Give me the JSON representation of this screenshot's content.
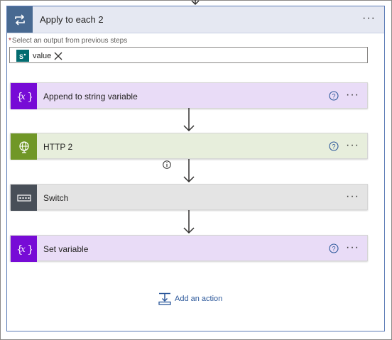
{
  "colors": {
    "loop_header": "#486991",
    "variable_accent": "#770bd6",
    "variable_bg": "#e9dcf7",
    "http_accent": "#709727",
    "http_bg": "#e7eedc",
    "switch_accent": "#484f58",
    "switch_bg": "#e4e4e4",
    "sharepoint": "#036c70",
    "link": "#2b579a"
  },
  "container": {
    "title": "Apply to each 2",
    "icon": "loop-icon",
    "more": "···"
  },
  "output_field": {
    "required_marker": "*",
    "label": "Select an output from previous steps",
    "token": {
      "icon": "sharepoint-icon",
      "text": "value"
    }
  },
  "actions": [
    {
      "title": "Append to string variable",
      "icon": "variable-icon",
      "help": true,
      "more": "···"
    },
    {
      "title": "HTTP 2",
      "icon": "globe-icon",
      "help": true,
      "more": "···"
    },
    {
      "title": "Switch",
      "icon": "switch-icon",
      "help": false,
      "more": "···"
    },
    {
      "title": "Set variable",
      "icon": "variable-icon",
      "help": true,
      "more": "···"
    }
  ],
  "add_action": {
    "label": "Add an action",
    "icon": "add-action-icon"
  }
}
